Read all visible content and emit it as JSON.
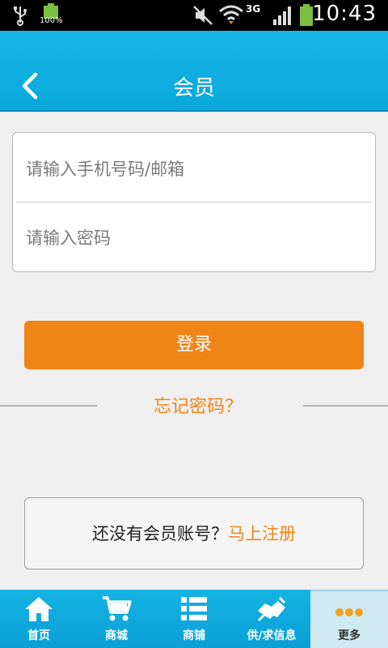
{
  "status_bar": {
    "battery_percent": "100%",
    "network_type": "3G",
    "time": "10:43"
  },
  "header": {
    "title": "会员"
  },
  "login": {
    "phone_placeholder": "请输入手机号码/邮箱",
    "password_placeholder": "请输入密码",
    "login_button": "登录",
    "forgot_password": "忘记密码？"
  },
  "register": {
    "prompt": "还没有会员账号？",
    "link": "马上注册"
  },
  "bottom_nav": {
    "items": [
      {
        "label": "首页",
        "icon": "home-icon"
      },
      {
        "label": "商城",
        "icon": "cart-icon"
      },
      {
        "label": "商铺",
        "icon": "list-icon"
      },
      {
        "label": "供/求信息",
        "icon": "handshake-icon"
      },
      {
        "label": "更多",
        "icon": "more-dots-icon"
      }
    ],
    "active_index": 4
  },
  "colors": {
    "header": "#0aa7db",
    "accent": "#f08517",
    "background": "#efefef"
  }
}
